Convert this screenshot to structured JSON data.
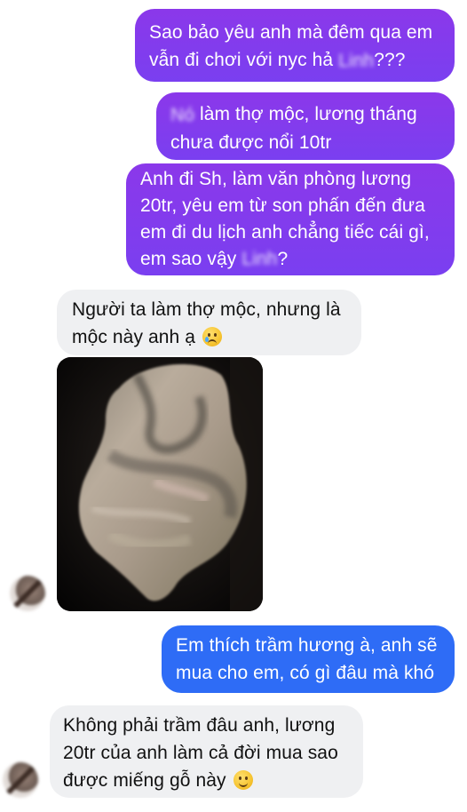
{
  "messages": [
    {
      "id": "m1",
      "direction": "sent",
      "lines": [
        "Sao bảo yêu anh mà đêm qua em",
        "vẫn đi chơi với nyc hả",
        "???"
      ],
      "blurred_word": "Linh"
    },
    {
      "id": "m2",
      "direction": "sent",
      "lines": [
        "làm thợ mộc, lương tháng",
        "chưa được nổi 10tr"
      ],
      "blurred_word": "Nó"
    },
    {
      "id": "m3",
      "direction": "sent",
      "lines": [
        "Anh đi Sh, làm văn phòng lương",
        "20tr, yêu em từ son phấn đến đưa",
        "em đi du lịch anh chẳng tiếc cái gì,",
        "em sao vậy",
        "?"
      ],
      "blurred_word": "Linh"
    },
    {
      "id": "m4",
      "direction": "received",
      "lines": [
        "Người ta làm thợ mộc, nhưng là",
        "mộc này anh ạ"
      ],
      "emoji": "crying-face"
    },
    {
      "id": "m5",
      "direction": "received",
      "type": "image",
      "alt": "piece of agarwood"
    },
    {
      "id": "m6",
      "direction": "sent",
      "lines": [
        "Em thích trầm hương à, anh sẽ",
        "mua cho em, có gì đâu mà khó"
      ]
    },
    {
      "id": "m7",
      "direction": "received",
      "lines": [
        "Không phải trầm đâu anh, lương",
        "20tr của anh làm cả đời mua sao",
        "được miếng gỗ này"
      ],
      "emoji": "slightly-smiling-face"
    }
  ],
  "colors": {
    "sent_purple": "#8b38ea",
    "sent_blue": "#2e6cf6",
    "received_bg": "#eff0f2"
  }
}
